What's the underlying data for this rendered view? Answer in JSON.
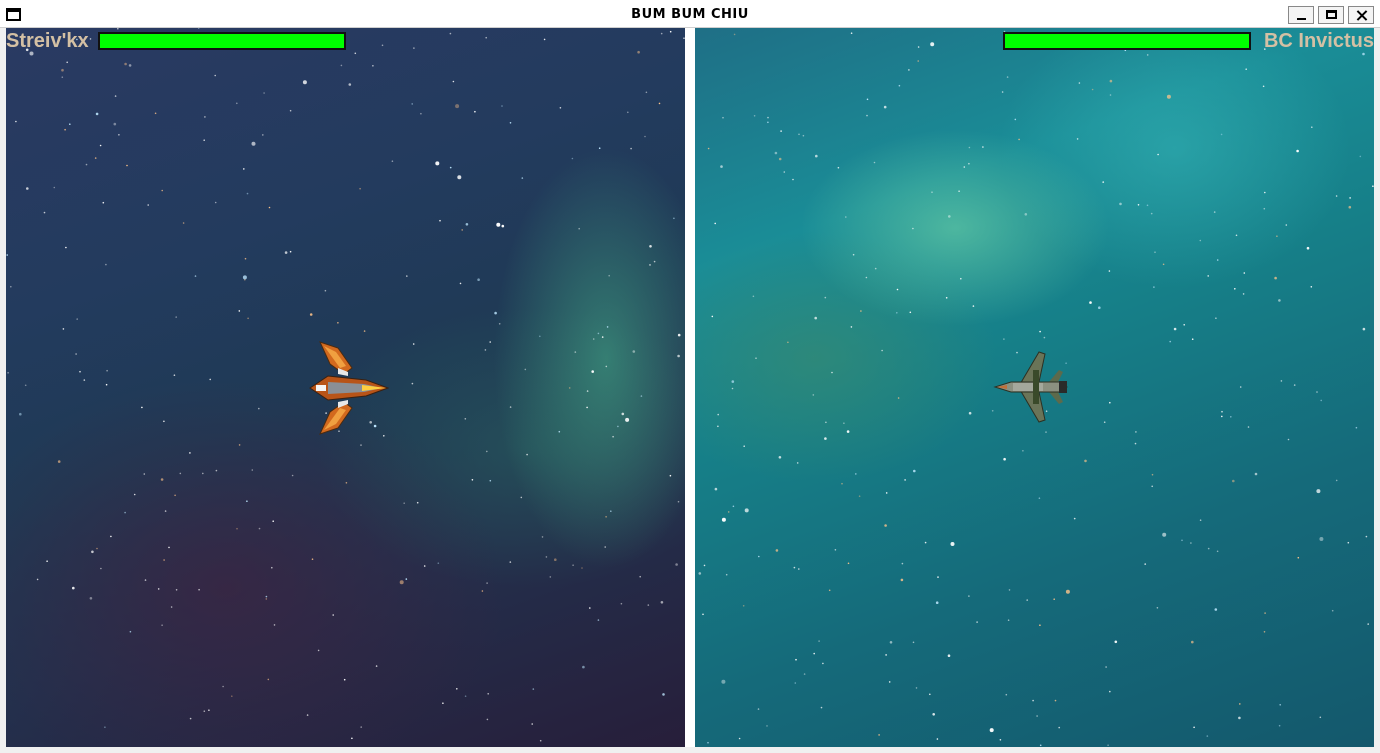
{
  "window": {
    "title": "BUM BUM CHIU",
    "icon": "window-icon",
    "controls": [
      "minimize-icon",
      "maximize-icon",
      "close-icon"
    ]
  },
  "players": [
    {
      "name": "Streiv'kx",
      "health": 1.0,
      "health_color": "#00ff00",
      "ship": "orange-fighter-ship-icon",
      "ship_color": "#e0701c"
    },
    {
      "name": "BC Invictus",
      "health": 1.0,
      "health_color": "#00ff00",
      "ship": "green-jet-fighter-ship-icon",
      "ship_color": "#6e7e5a"
    }
  ],
  "colors": {
    "name_text": "#d4c0a4",
    "left_space": "#233b5e",
    "right_space": "#167f88",
    "divider": "#ffffff"
  }
}
